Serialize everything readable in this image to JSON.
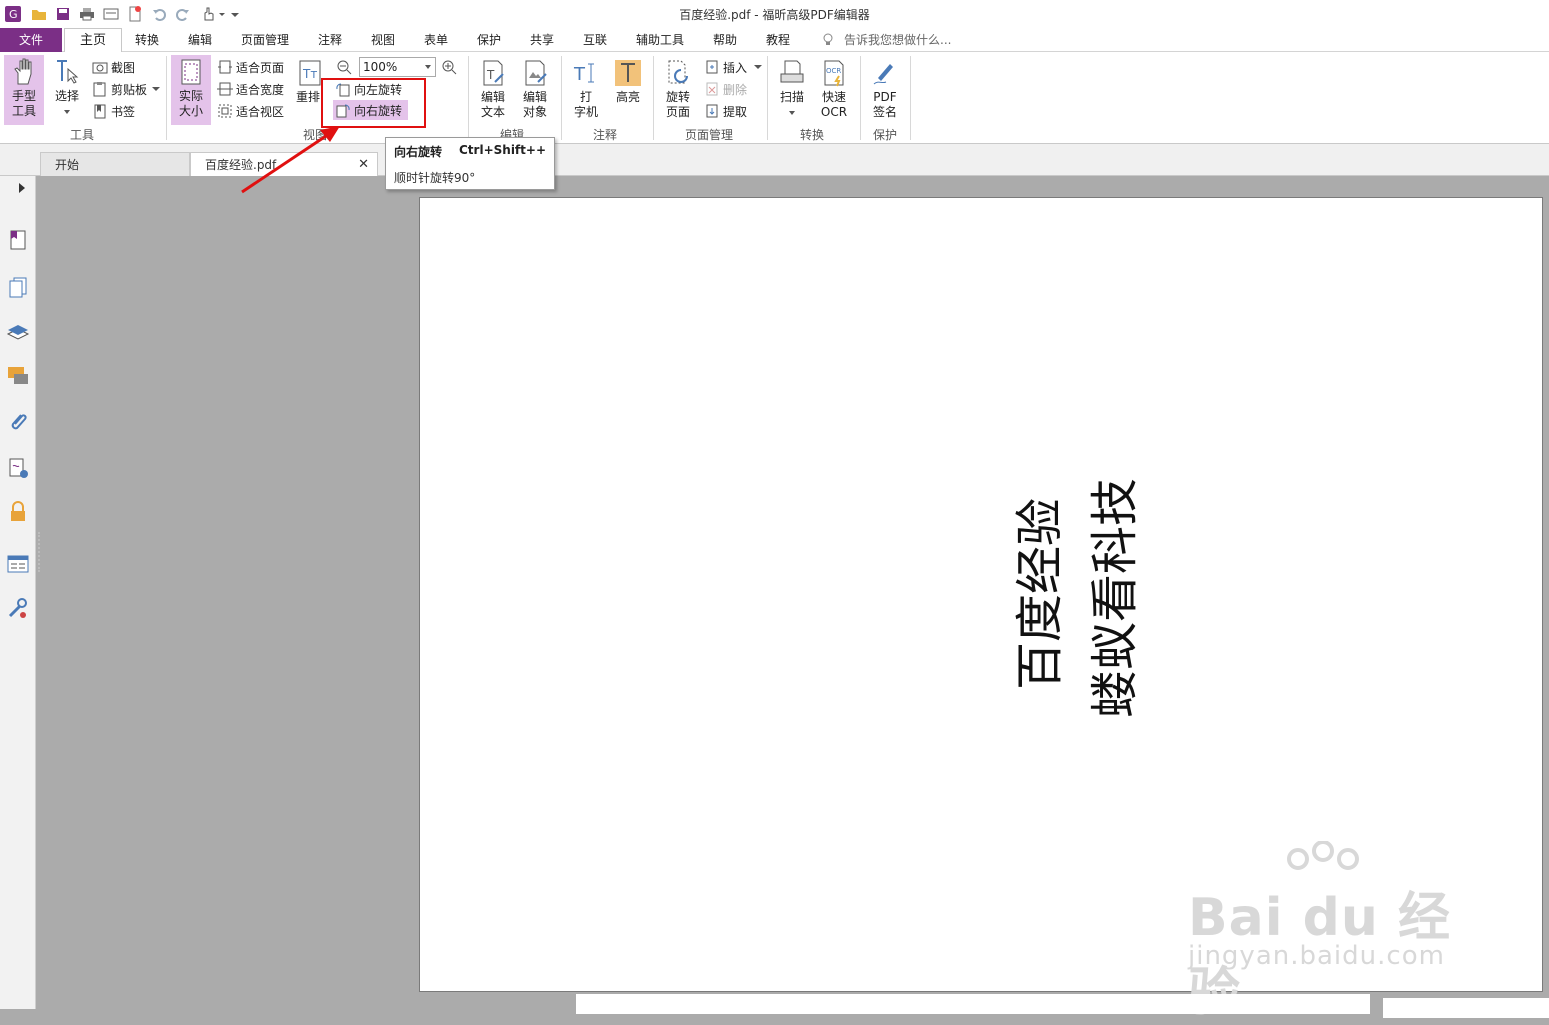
{
  "window": {
    "title": "百度经验.pdf - 福昕高级PDF编辑器"
  },
  "menu": {
    "tabs": [
      "文件",
      "主页",
      "转换",
      "编辑",
      "页面管理",
      "注释",
      "视图",
      "表单",
      "保护",
      "共享",
      "互联",
      "辅助工具",
      "帮助",
      "教程"
    ],
    "active": "主页",
    "search_placeholder": "告诉我您想做什么..."
  },
  "ribbon": {
    "tools": {
      "hand": "手型\n工具",
      "select": "选择",
      "screenshot": "截图",
      "clipboard": "剪贴板",
      "bookmark": "书签",
      "group": "工具"
    },
    "view": {
      "actual_size": "实际\n大小",
      "fit_page": "适合页面",
      "fit_width": "适合宽度",
      "fit_visible": "适合视区",
      "reflow": "重排",
      "zoom": "100%",
      "rotate_left": "向左旋转",
      "rotate_right": "向右旋转",
      "group": "视图"
    },
    "edit": {
      "edit_text": "编辑\n文本",
      "edit_object": "编辑\n对象",
      "group": "编辑"
    },
    "comment": {
      "typewriter": "打\n字机",
      "highlight": "高亮",
      "group": "注释"
    },
    "page_mgmt": {
      "rotate_page": "旋转\n页面",
      "insert": "插入",
      "delete": "删除",
      "extract": "提取",
      "group": "页面管理"
    },
    "convert": {
      "scan": "扫描",
      "quick_ocr": "快速\nOCR",
      "group": "转换"
    },
    "protect": {
      "pdf_sign": "PDF\n签名",
      "group": "保护"
    }
  },
  "tooltip": {
    "title": "向右旋转",
    "shortcut": "Ctrl+Shift++",
    "desc": "顺时针旋转90°"
  },
  "doc_tabs": [
    "开始",
    "百度经验.pdf"
  ],
  "page": {
    "text1": "百度经验",
    "text2": "蝼蚁看科技"
  },
  "watermark": {
    "brand": "Bai du 经验",
    "url": "jingyan.baidu.com"
  },
  "colors": {
    "brand": "#7b2f86",
    "highlight": "#e4c3ea",
    "annotation": "#e01010"
  }
}
